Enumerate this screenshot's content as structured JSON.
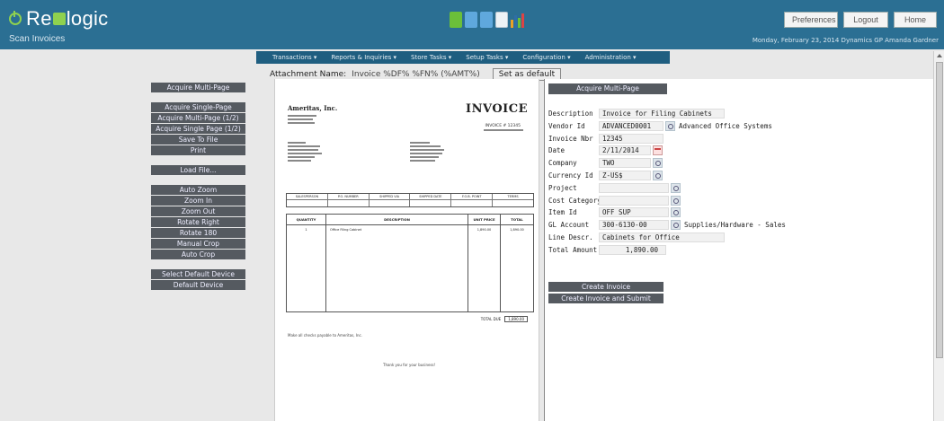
{
  "app": {
    "brand": "ReQlogic",
    "brand_pre": "Re",
    "brand_post": "logic",
    "page_title": "Scan Invoices",
    "userline": "Monday, February 23, 2014   Dynamics GP   Amanda Gardner"
  },
  "top_buttons": {
    "preferences": "Preferences",
    "logout": "Logout",
    "home": "Home"
  },
  "nav": [
    "Transactions ▾",
    "Reports & Inquiries ▾",
    "Store Tasks ▾",
    "Setup Tasks ▾",
    "Configuration ▾",
    "Administration ▾"
  ],
  "attachment": {
    "label": "Attachment Name:",
    "value": "Invoice %DF% %FN% (%AMT%)",
    "set_default": "Set as default"
  },
  "left_buttons": {
    "acquire_multi": "Acquire Multi-Page",
    "acquire_single": "Acquire Single-Page",
    "acquire_multi_half": "Acquire Multi-Page (1/2)",
    "acquire_single_half": "Acquire Single Page (1/2)",
    "save_file": "Save To File",
    "print": "Print",
    "load_file": "Load File...",
    "auto_zoom": "Auto Zoom",
    "zoom_in": "Zoom In",
    "zoom_out": "Zoom Out",
    "rotate_right": "Rotate Right",
    "rotate_180": "Rotate 180",
    "manual_crop": "Manual Crop",
    "auto_crop": "Auto Crop",
    "select_device": "Select Default Device",
    "default_device": "Default Device"
  },
  "document": {
    "company": "Ameritas, Inc.",
    "title": "INVOICE",
    "invoice_no": "INVOICE # 12345",
    "table1_headers": [
      "SALESPERSON",
      "P.O. NUMBER",
      "SHIPPED VIA",
      "SHIPPED DATE",
      "F.O.B. POINT",
      "TERMS"
    ],
    "table2_headers": [
      "QUANTITY",
      "DESCRIPTION",
      "UNIT PRICE",
      "TOTAL"
    ],
    "line_qty": "1",
    "line_desc": "Office Filing Cabinet",
    "line_price": "1,890.00",
    "line_total": "1,890.00",
    "total_label": "TOTAL DUE",
    "total_value": "1,890.00",
    "footer_note": "Make all checks payable to Ameritas, Inc.",
    "thanks": "Thank you for your business!"
  },
  "right_panel": {
    "acquire_multi": "Acquire Multi-Page",
    "fields": {
      "description_label": "Description",
      "description_value": "Invoice for Filing Cabinets",
      "vendor_label": "Vendor Id",
      "vendor_value": "ADVANCED0001",
      "vendor_name": "Advanced Office Systems",
      "invoice_label": "Invoice Nbr",
      "invoice_value": "12345",
      "date_label": "Date",
      "date_value": "2/11/2014",
      "company_label": "Company",
      "company_value": "TWO",
      "currency_label": "Currency Id",
      "currency_value": "Z-US$",
      "project_label": "Project",
      "project_value": "",
      "cost_label": "Cost Category",
      "cost_value": "",
      "item_label": "Item Id",
      "item_value": "OFF SUP",
      "gl_label": "GL Account",
      "gl_value": "300-6130-00",
      "gl_name": "Supplies/Hardware - Sales",
      "line_label": "Line Descr.",
      "line_value": "Cabinets for Office",
      "amount_label": "Total Amount",
      "amount_value": "1,890.00"
    },
    "create_invoice": "Create Invoice",
    "create_submit": "Create Invoice and Submit"
  }
}
